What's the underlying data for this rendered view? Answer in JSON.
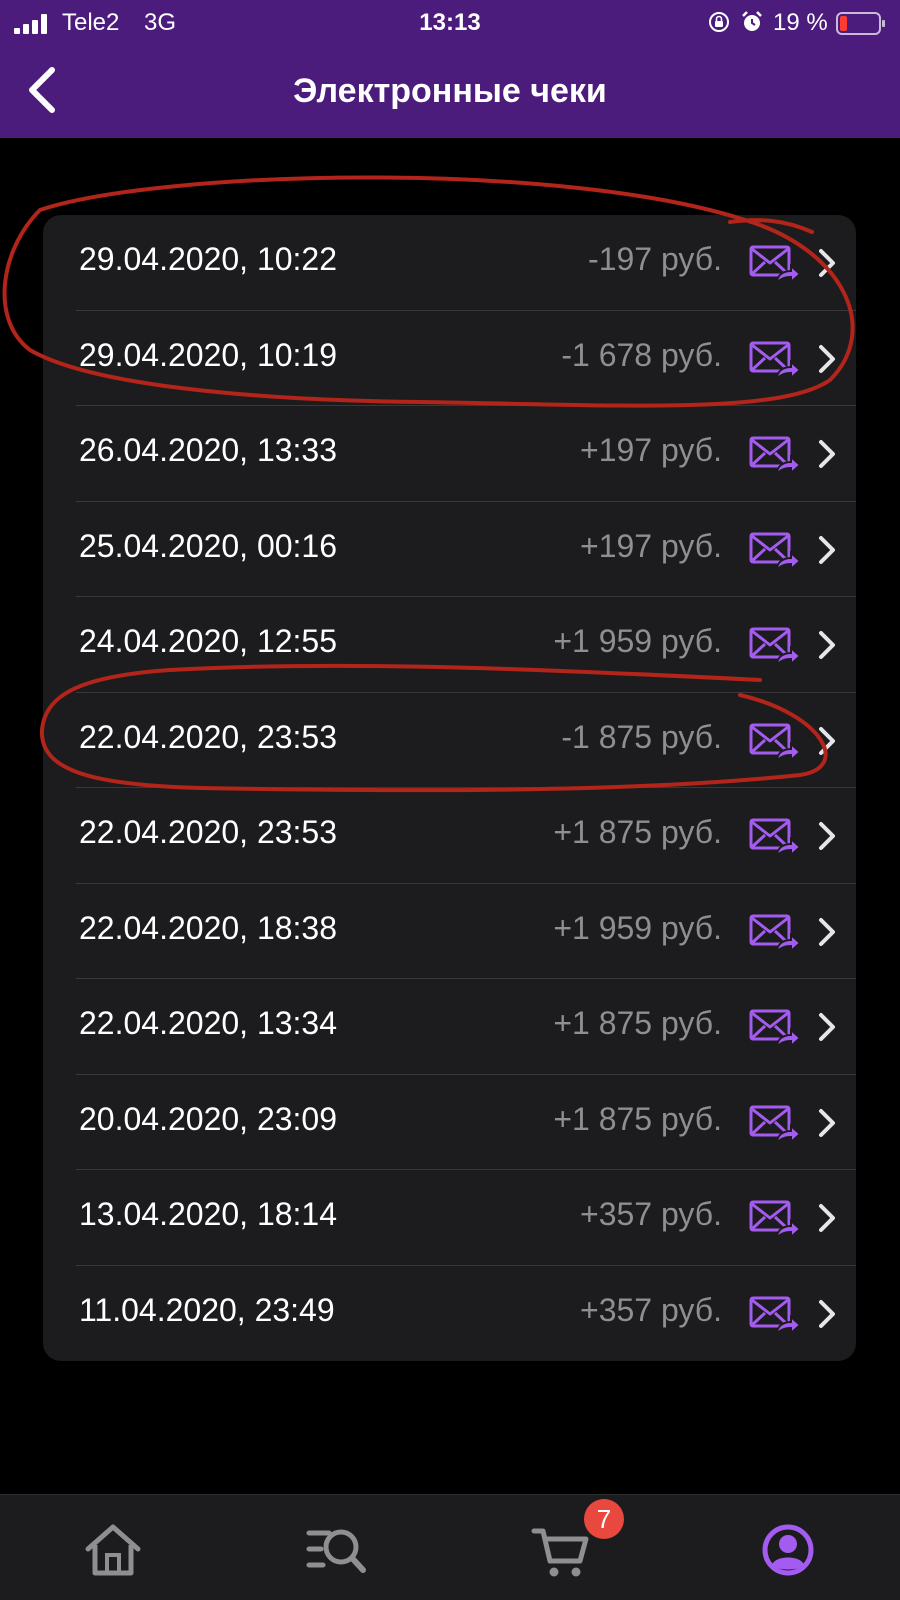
{
  "status_bar": {
    "carrier": "Tele2",
    "network": "3G",
    "time": "13:13",
    "battery": "19 %"
  },
  "header": {
    "title": "Электронные чеки",
    "back_icon": "chevron-left-icon"
  },
  "receipts": [
    {
      "date": "29.04.2020, 10:22",
      "amount": "-197 руб."
    },
    {
      "date": "29.04.2020, 10:19",
      "amount": "-1 678 руб."
    },
    {
      "date": "26.04.2020, 13:33",
      "amount": "+197 руб."
    },
    {
      "date": "25.04.2020, 00:16",
      "amount": "+197 руб."
    },
    {
      "date": "24.04.2020, 12:55",
      "amount": "+1 959 руб."
    },
    {
      "date": "22.04.2020, 23:53",
      "amount": "-1 875 руб."
    },
    {
      "date": "22.04.2020, 23:53",
      "amount": "+1 875 руб."
    },
    {
      "date": "22.04.2020, 18:38",
      "amount": "+1 959 руб."
    },
    {
      "date": "22.04.2020, 13:34",
      "amount": "+1 875 руб."
    },
    {
      "date": "20.04.2020, 23:09",
      "amount": "+1 875 руб."
    },
    {
      "date": "13.04.2020, 18:14",
      "amount": "+357 руб."
    },
    {
      "date": "11.04.2020, 23:49",
      "amount": "+357 руб."
    }
  ],
  "row_icons": {
    "send": "mail-forward-icon",
    "open": "chevron-right-icon"
  },
  "tabbar": {
    "items": [
      {
        "icon": "home-icon"
      },
      {
        "icon": "search-catalog-icon"
      },
      {
        "icon": "cart-icon"
      },
      {
        "icon": "profile-icon",
        "active": true
      }
    ],
    "cart_badge": "7"
  },
  "colors": {
    "header_bg": "#4b1c7c",
    "accent": "#a35bf0",
    "list_bg": "#1c1c1e",
    "amount_text": "#8e8e93",
    "badge": "#e8483e",
    "annotation": "#b3241a"
  }
}
